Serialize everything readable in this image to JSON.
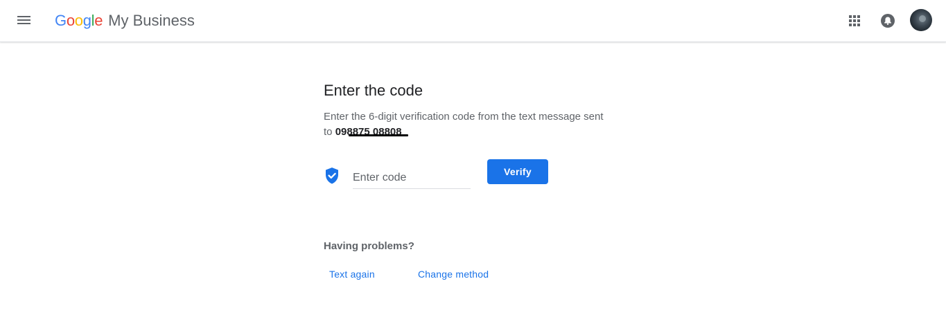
{
  "header": {
    "menu_icon": "hamburger-menu-icon",
    "logo": {
      "letters": [
        {
          "char": "G",
          "color": "#4285F4"
        },
        {
          "char": "o",
          "color": "#EA4335"
        },
        {
          "char": "o",
          "color": "#FBBC05"
        },
        {
          "char": "g",
          "color": "#4285F4"
        },
        {
          "char": "l",
          "color": "#34A853"
        },
        {
          "char": "e",
          "color": "#EA4335"
        }
      ],
      "product_name": "My Business"
    },
    "apps_icon": "apps-grid-icon",
    "notifications_icon": "notification-bell-icon",
    "avatar_icon": "user-avatar"
  },
  "main": {
    "title": "Enter the code",
    "description": "Enter the 6-digit verification code from the text message sent to",
    "phone_number": "098875 08808",
    "code_input": {
      "placeholder": "Enter code",
      "value": "",
      "icon": "verified-shield-icon"
    },
    "verify_label": "Verify",
    "problems_heading": "Having problems?",
    "links": {
      "text_again": "Text again",
      "change_method": "Change method"
    }
  },
  "colors": {
    "primary": "#1a73e8",
    "text": "#202124",
    "secondary_text": "#5f6368"
  }
}
